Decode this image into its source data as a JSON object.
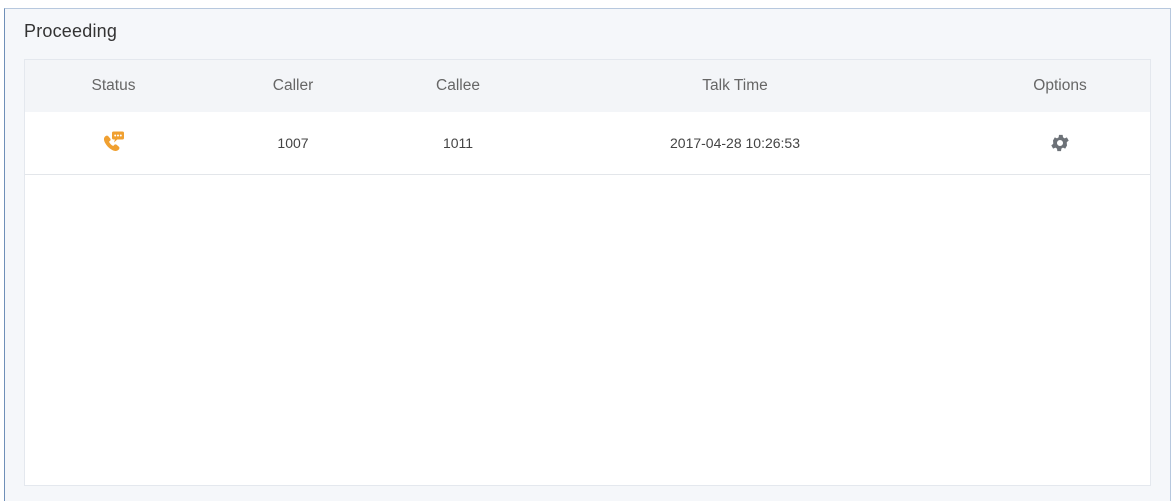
{
  "panel": {
    "title": "Proceeding"
  },
  "table": {
    "columns": {
      "status": "Status",
      "caller": "Caller",
      "callee": "Callee",
      "talk_time": "Talk Time",
      "options": "Options"
    },
    "rows": [
      {
        "status_icon": "phone-talking-icon",
        "caller": "1007",
        "callee": "1011",
        "talk_time": "2017-04-28 10:26:53",
        "options_icon": "gear-icon"
      }
    ]
  },
  "colors": {
    "status_icon": "#f0a030",
    "gear_icon": "#6d7278",
    "header_bg": "#f3f5f8",
    "panel_bg": "#f5f7fa"
  }
}
